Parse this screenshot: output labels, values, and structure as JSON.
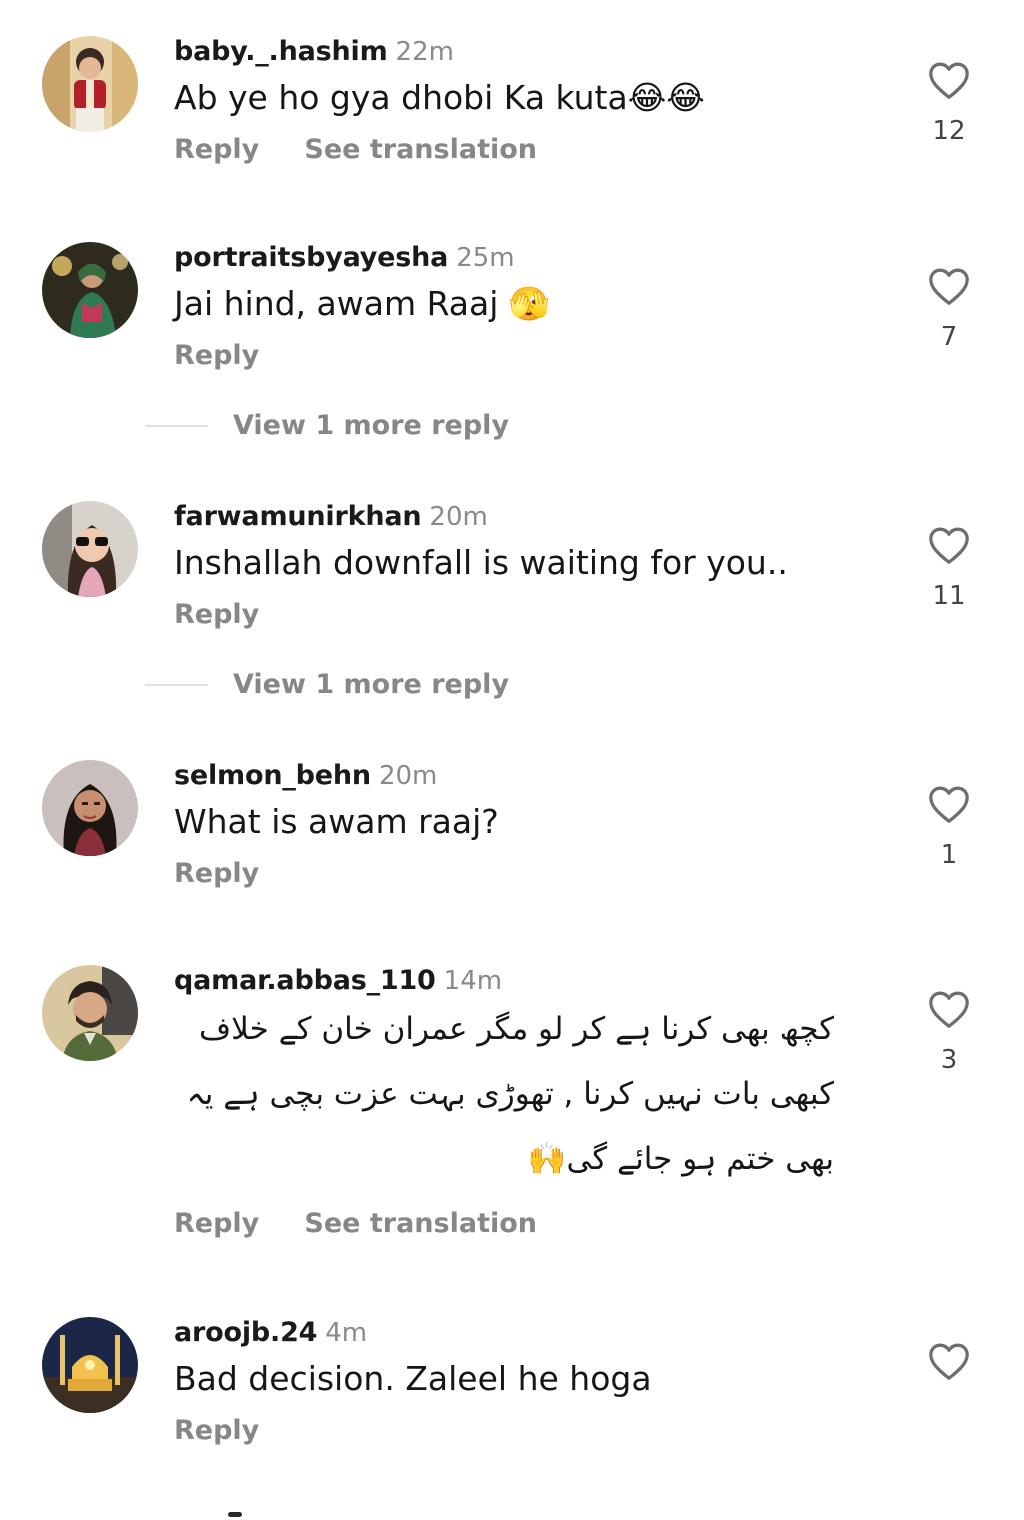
{
  "comments": [
    {
      "username": "baby._.hashim",
      "time": "22m",
      "text": "Ab ye ho gya dhobi Ka kuta😂😂",
      "reply": "Reply",
      "translation": "See translation",
      "likes": "12"
    },
    {
      "username": "portraitsbyayesha",
      "time": "25m",
      "text": "Jai hind, awam Raaj 🫣",
      "reply": "Reply",
      "likes": "7",
      "more_replies": "View 1 more reply"
    },
    {
      "username": "farwamunirkhan",
      "time": "20m",
      "text": "Inshallah downfall is waiting for you..",
      "reply": "Reply",
      "likes": "11",
      "more_replies": "View 1 more reply"
    },
    {
      "username": "selmon_behn",
      "time": "20m",
      "text": "What is awam raaj?",
      "reply": "Reply",
      "likes": "1"
    },
    {
      "username": "qamar.abbas_110",
      "time": "14m",
      "text": "کچھ بھی کرنا ہے کر لو مگر عمران خان کے خلاف کبھی بات نہیں کرنا , تھوڑی بہت عزت بچی ہے یہ بھی ختم ہو جائے گی🙌",
      "reply": "Reply",
      "translation": "See translation",
      "likes": "3"
    },
    {
      "username": "aroojb.24",
      "time": "4m",
      "text": "Bad decision. Zaleel he hoga",
      "reply": "Reply",
      "likes": ""
    }
  ],
  "icons": {
    "like": "heart-outline-icon"
  },
  "colors": {
    "username": "#1a1a1a",
    "secondary": "#878787",
    "text": "#161616",
    "heart": "#6e6e6e"
  }
}
